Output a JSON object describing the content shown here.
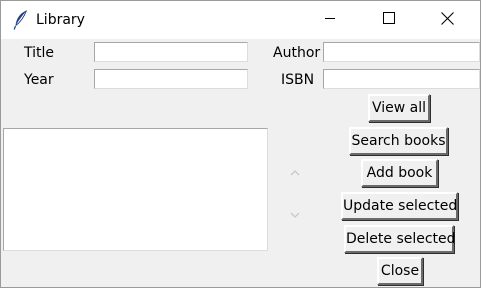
{
  "window": {
    "title": "Library",
    "icon": "feather-icon",
    "controls": {
      "minimize_icon": "minimize-icon",
      "maximize_icon": "maximize-icon",
      "close_icon": "close-icon"
    }
  },
  "form": {
    "title_label": "Title",
    "year_label": "Year",
    "author_label": "Author",
    "isbn_label": "ISBN",
    "title_value": "",
    "year_value": "",
    "author_value": "",
    "isbn_value": ""
  },
  "listbox": {
    "items": []
  },
  "buttons": {
    "view_all": "View all",
    "search_books": "Search books",
    "add_book": "Add book",
    "update_selected": "Update selected",
    "delete_selected": "Delete selected",
    "close": "Close"
  },
  "colors": {
    "window_bg": "#f0f0f0",
    "titlebar_bg": "#ffffff",
    "entry_bg": "#ffffff",
    "scroll_arrow": "#c8c8c8"
  }
}
